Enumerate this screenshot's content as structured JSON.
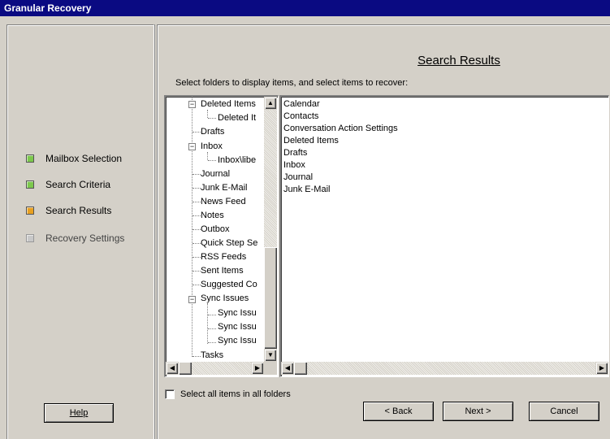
{
  "window": {
    "title": "Granular Recovery"
  },
  "steps": [
    {
      "label": "Mailbox Selection",
      "color": "#7cc84c"
    },
    {
      "label": "Search Criteria",
      "color": "#7cc84c"
    },
    {
      "label": "Search Results",
      "color": "#e8a020"
    },
    {
      "label": "Recovery Settings",
      "color": "#c8c8c8"
    }
  ],
  "help_label": "Help",
  "page": {
    "title": "Search Results",
    "instructions": "Select folders to display items, and select items to recover:"
  },
  "tree": {
    "items": [
      "Deleted Items",
      "Deleted It",
      "Drafts",
      "Inbox",
      "Inbox\\libe",
      "Journal",
      "Junk E-Mail",
      "News Feed",
      "Notes",
      "Outbox",
      "Quick Step Se",
      "RSS Feeds",
      "Sent Items",
      "Suggested Co",
      "Sync Issues",
      "Sync Issu",
      "Sync Issu",
      "Sync Issu",
      "Tasks"
    ]
  },
  "items_list": {
    "items": [
      "Calendar",
      "Contacts",
      "Conversation Action Settings",
      "Deleted Items",
      "Drafts",
      "Inbox",
      "Journal",
      "Junk E-Mail"
    ]
  },
  "select_all_label": "Select all items in all folders",
  "buttons": {
    "back": "< Back",
    "next": "Next >",
    "cancel": "Cancel"
  }
}
